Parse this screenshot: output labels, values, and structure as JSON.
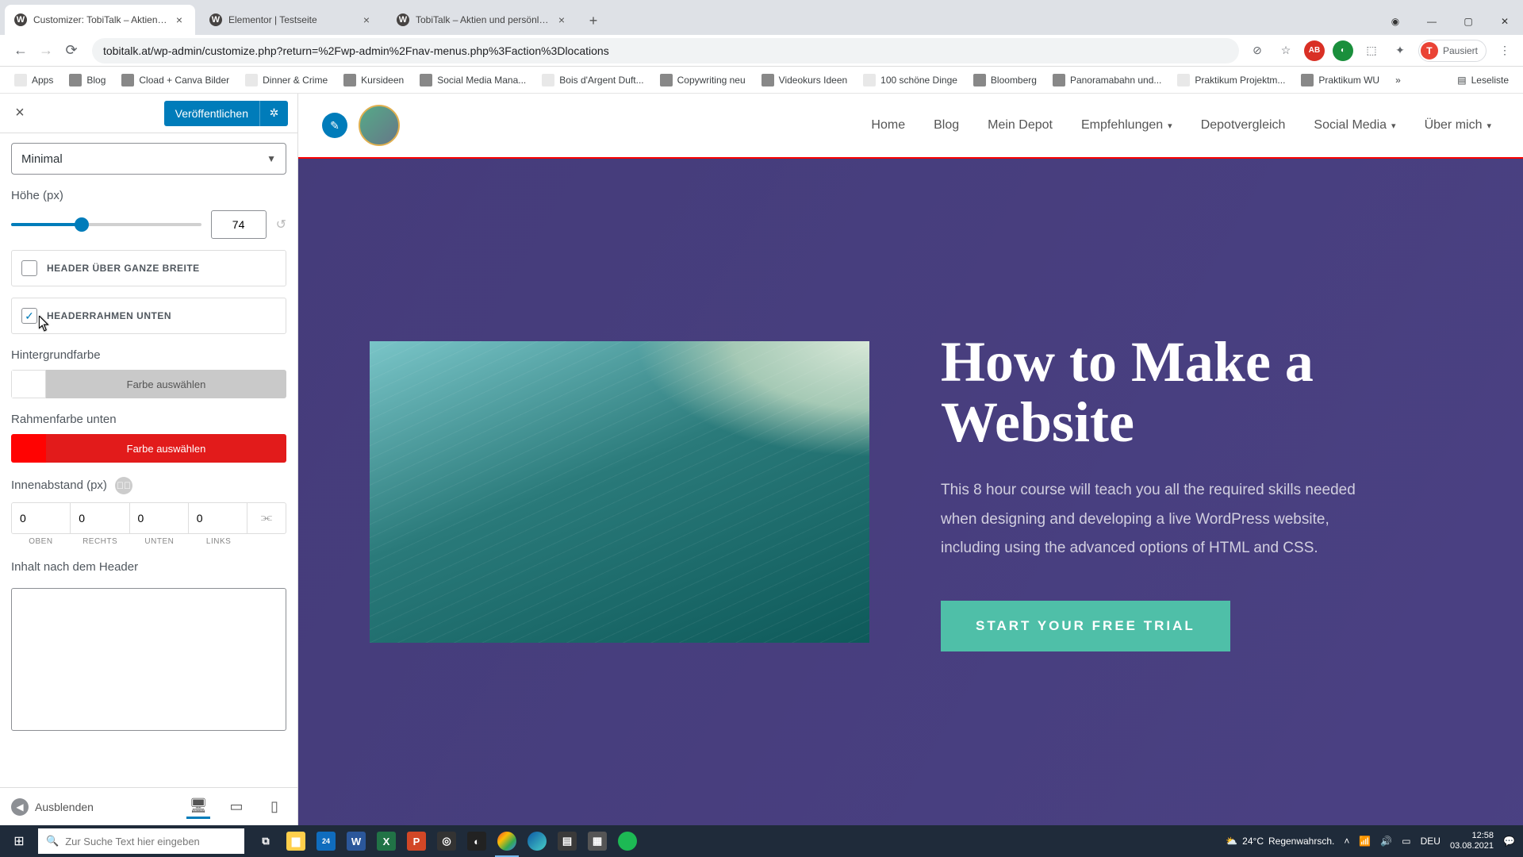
{
  "browser": {
    "tabs": [
      {
        "title": "Customizer: TobiTalk – Aktien un"
      },
      {
        "title": "Elementor | Testseite"
      },
      {
        "title": "TobiTalk – Aktien und persönlich"
      }
    ],
    "url": "tobitalk.at/wp-admin/customize.php?return=%2Fwp-admin%2Fnav-menus.php%3Faction%3Dlocations",
    "paused": "Pausiert",
    "avatar_letter": "T"
  },
  "bookmarks": [
    {
      "label": "Apps",
      "icon": "apps"
    },
    {
      "label": "Blog"
    },
    {
      "label": "Cload + Canva Bilder"
    },
    {
      "label": "Dinner & Crime"
    },
    {
      "label": "Kursideen"
    },
    {
      "label": "Social Media Mana..."
    },
    {
      "label": "Bois d'Argent Duft..."
    },
    {
      "label": "Copywriting neu"
    },
    {
      "label": "Videokurs Ideen"
    },
    {
      "label": "100 schöne Dinge"
    },
    {
      "label": "Bloomberg"
    },
    {
      "label": "Panoramabahn und..."
    },
    {
      "label": "Praktikum Projektm..."
    },
    {
      "label": "Praktikum WU"
    }
  ],
  "readlist": "Leseliste",
  "customizer": {
    "publish": "Veröffentlichen",
    "preset": "Minimal",
    "height_label": "Höhe (px)",
    "height_value": "74",
    "chk_fullwidth": "HEADER ÜBER GANZE BREITE",
    "chk_borderbottom": "HEADERRAHMEN UNTEN",
    "bgcolor_label": "Hintergrundfarbe",
    "bgcolor_btn": "Farbe auswählen",
    "bordercolor_label": "Rahmenfarbe unten",
    "bordercolor_btn": "Farbe auswählen",
    "padding_label": "Innenabstand (px)",
    "padding": {
      "top": "0",
      "right": "0",
      "bottom": "0",
      "left": "0"
    },
    "padding_sides": {
      "top": "OBEN",
      "right": "RECHTS",
      "bottom": "UNTEN",
      "left": "LINKS"
    },
    "afterheader_label": "Inhalt nach dem Header",
    "hide": "Ausblenden"
  },
  "site": {
    "nav": [
      "Home",
      "Blog",
      "Mein Depot",
      "Empfehlungen",
      "Depotvergleich",
      "Social Media",
      "Über mich"
    ],
    "nav_dd": [
      false,
      false,
      false,
      true,
      false,
      true,
      true
    ],
    "hero_title": "How to Make a Website",
    "hero_body": "This 8 hour course will teach you all the required skills needed when designing and developing a live WordPress website, including using the advanced options of HTML and CSS.",
    "cta": "START YOUR FREE TRIAL"
  },
  "taskbar": {
    "search_placeholder": "Zur Suche Text hier eingeben",
    "weather_temp": "24°C",
    "weather_text": "Regenwahrsch.",
    "lang": "DEU",
    "time": "12:58",
    "date": "03.08.2021",
    "mail_badge": "24"
  }
}
